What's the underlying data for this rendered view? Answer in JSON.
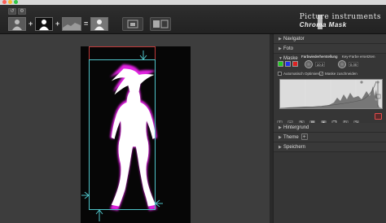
{
  "toolbar": {
    "plus_1": "+",
    "plus_2": "+",
    "equals": "="
  },
  "brand": {
    "name": "Picture instruments",
    "product": "Chroma Mask"
  },
  "panel": {
    "sections": [
      {
        "label": "Navigator"
      },
      {
        "label": "Foto"
      },
      {
        "label": "Maske"
      },
      {
        "label": "Hintergrund"
      },
      {
        "label": "Theme",
        "has_add": true,
        "add_label": "+"
      },
      {
        "label": "Speichern"
      }
    ],
    "mask": {
      "tabs": [
        "Farbwiederherstellung",
        "Key-Farbe ersetzten"
      ],
      "swatch_colors": [
        "#22cc22",
        "#2233ee",
        "#dd2222"
      ],
      "knob_1_value": "10.0",
      "knob_2_value": "0.00",
      "auto_optimize_label": "Automatisch Optimieren",
      "auto_optimize_checked": false,
      "mask_crop_label": "Maske zuschneiden",
      "mask_crop_checked": true,
      "checkmark": "✓"
    }
  },
  "colors": {
    "accent_magenta": "#e020e0",
    "selection_cyan": "#4fc3c8",
    "frame_red": "#c23a3a"
  }
}
